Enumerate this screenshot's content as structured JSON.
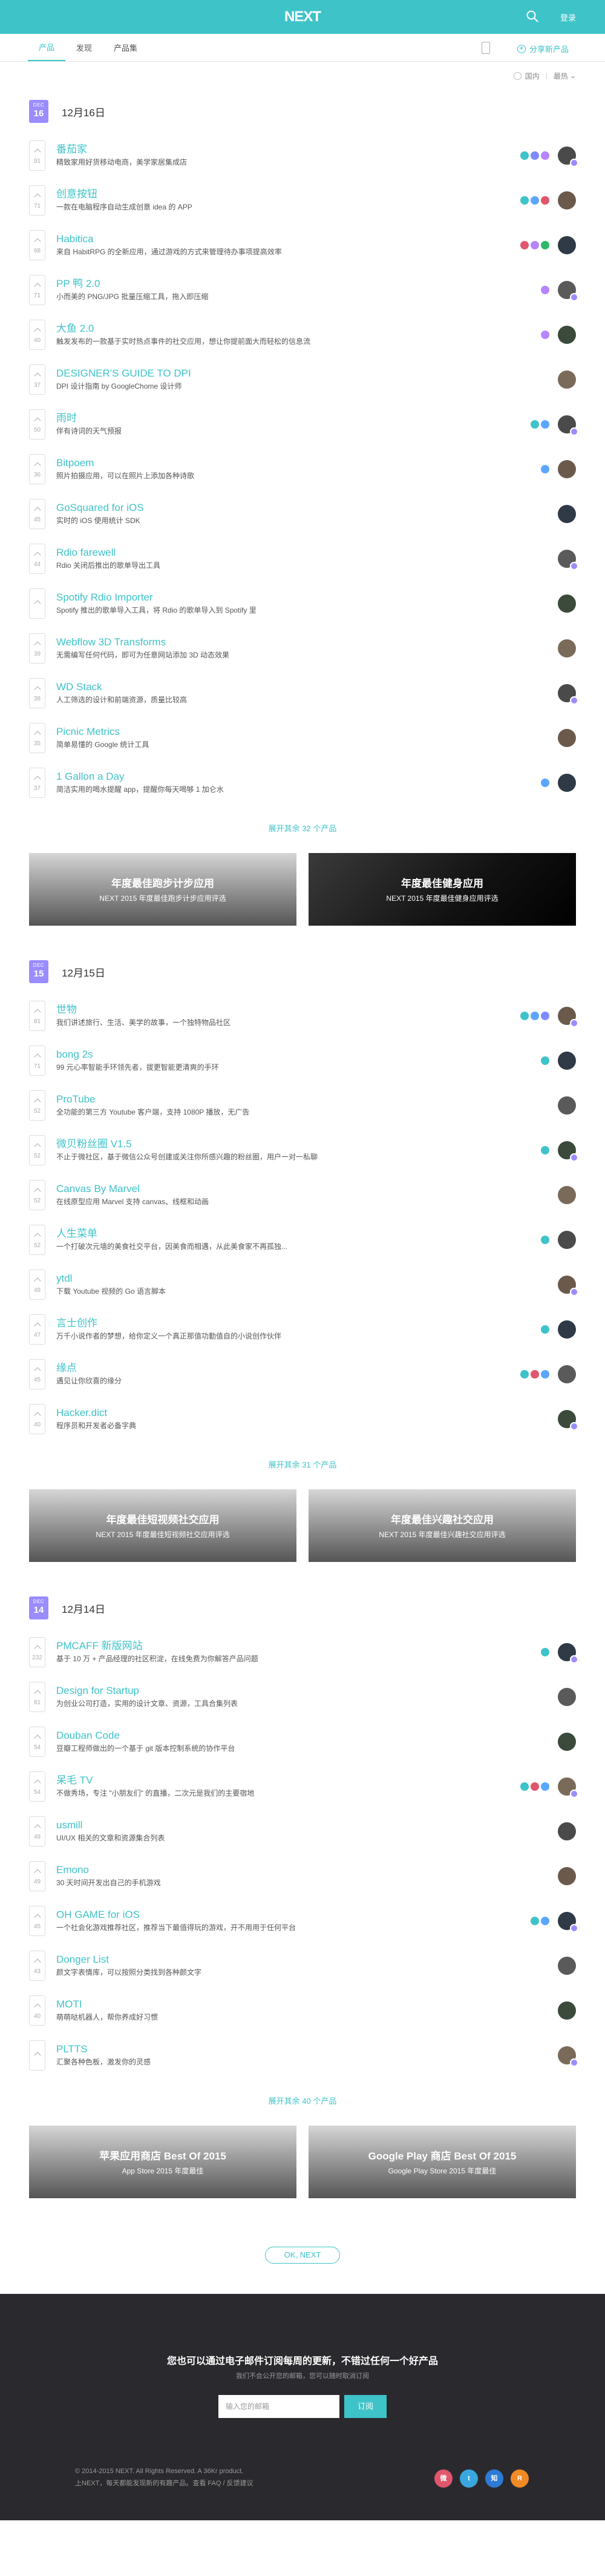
{
  "header": {
    "logo": "NEXT",
    "login": "登录"
  },
  "tabs": [
    {
      "label": "产品"
    },
    {
      "label": "发现"
    },
    {
      "label": "产品集"
    }
  ],
  "share_label": "分享新产品",
  "filter": {
    "region": "国内",
    "sort": "最热"
  },
  "days": [
    {
      "month": "DEC",
      "day": "16",
      "title": "12月16日",
      "items": [
        {
          "name": "番茄家",
          "desc": "精致家用好货移动电商，美学家居集成店",
          "votes": "91",
          "tags": [
            "#3ec3c9",
            "#7c8bff",
            "#b586ff"
          ]
        },
        {
          "name": "创意按钮",
          "desc": "一款在电脑程序自动生成创意 idea 的 APP",
          "votes": "71",
          "tags": [
            "#3ec3c9",
            "#5ca6ff",
            "#e0566c"
          ]
        },
        {
          "name": "Habitica",
          "desc": "来自 HabitRPG 的全新应用，通过游戏的方式来管理待办事项提高效率",
          "votes": "68",
          "tags": [
            "#e0566c",
            "#b586ff",
            "#2fb86a"
          ]
        },
        {
          "name": "PP 鸭 2.0",
          "desc": "小而美的 PNG/JPG 批量压缩工具，拖入即压缩",
          "votes": "71",
          "tags": [
            "#b586ff"
          ]
        },
        {
          "name": "大鱼 2.0",
          "desc": "触发发布的一款基于实时热点事件的社交应用，想让你提前面大而轻松的信息流",
          "votes": "40",
          "tags": [
            "#b586ff"
          ]
        },
        {
          "name": "DESIGNER'S GUIDE TO DPI",
          "desc": "DPI 设计指南 by GoogleChome 设计师",
          "votes": "37",
          "tags": []
        },
        {
          "name": "雨时",
          "desc": "伴有诗词的天气预报",
          "votes": "50",
          "tags": [
            "#3ec3c9",
            "#5ca6ff"
          ]
        },
        {
          "name": "Bitpoem",
          "desc": "照片拍摄应用，可以在照片上添加各种诗歌",
          "votes": "36",
          "tags": [
            "#5ca6ff"
          ]
        },
        {
          "name": "GoSquared for iOS",
          "desc": "实时的 iOS 使用统计 SDK",
          "votes": "45",
          "tags": []
        },
        {
          "name": "Rdio farewell",
          "desc": "Rdio 关闭后推出的歌单导出工具",
          "votes": "44",
          "tags": []
        },
        {
          "name": "Spotify Rdio Importer",
          "desc": "Spotify 推出的歌单导入工具，将 Rdio 的歌单导入到 Spotify 里",
          "votes": "",
          "tags": []
        },
        {
          "name": "Webflow 3D Transforms",
          "desc": "无需编写任何代码，即可为任意网站添加 3D 动态效果",
          "votes": "39",
          "tags": []
        },
        {
          "name": "WD Stack",
          "desc": "人工筛选的设计和前端资源，质量比较高",
          "votes": "38",
          "tags": []
        },
        {
          "name": "Picnic Metrics",
          "desc": "简单易懂的 Google 统计工具",
          "votes": "35",
          "tags": []
        },
        {
          "name": "1 Gallon a Day",
          "desc": "简洁实用的喝水提醒 app，提醒你每天喝够 1 加仑水",
          "votes": "37",
          "tags": [
            "#5ca6ff"
          ]
        }
      ],
      "more": "展开其余 32 个产品",
      "banners": [
        {
          "title": "年度最佳跑步计步应用",
          "sub": "NEXT 2015 年度最佳跑步计步应用评选",
          "dark": false
        },
        {
          "title": "年度最佳健身应用",
          "sub": "NEXT 2015 年度最佳健身应用评选",
          "dark": true
        }
      ]
    },
    {
      "month": "DEC",
      "day": "15",
      "title": "12月15日",
      "items": [
        {
          "name": "世物",
          "desc": "我们讲述旅行、生活、美学的故事，一个独特物品社区",
          "votes": "81",
          "tags": [
            "#3ec3c9",
            "#5ca6ff",
            "#7c8bff"
          ]
        },
        {
          "name": "bong 2s",
          "desc": "99 元心率智能手环领先者，拔更智能更清爽的手环",
          "votes": "71",
          "tags": [
            "#3ec3c9"
          ]
        },
        {
          "name": "ProTube",
          "desc": "全功能的第三方 Youtube 客户端，支持 1080P 播放，无广告",
          "votes": "52",
          "tags": []
        },
        {
          "name": "微贝粉丝圈 V1.5",
          "desc": "不止于微社区，基于微信公众号创建或关注你所感兴趣的粉丝圈，用户一对一私聊",
          "votes": "52",
          "tags": [
            "#3ec3c9"
          ]
        },
        {
          "name": "Canvas By Marvel",
          "desc": "在线原型应用 Marvel 支持 canvas、线框和动画",
          "votes": "52",
          "tags": []
        },
        {
          "name": "人生菜单",
          "desc": "一个打破次元墙的美食社交平台，因美食而相遇，从此美食家不再孤独...",
          "votes": "52",
          "tags": [
            "#3ec3c9"
          ]
        },
        {
          "name": "ytdl",
          "desc": "下载 Youtube 视频的 Go 语言脚本",
          "votes": "48",
          "tags": []
        },
        {
          "name": "言士创作",
          "desc": "万千小说作者的梦想，给你定义一个真正那值功勤值自的小说创作伙伴",
          "votes": "47",
          "tags": [
            "#3ec3c9"
          ]
        },
        {
          "name": "缘点",
          "desc": "遇见让你欣喜的缘分",
          "votes": "45",
          "tags": [
            "#3ec3c9",
            "#e0566c",
            "#5ca6ff"
          ]
        },
        {
          "name": "Hacker.dict",
          "desc": "程序员和开发者必备字典",
          "votes": "40",
          "tags": []
        }
      ],
      "more": "展开其余 31 个产品",
      "banners": [
        {
          "title": "年度最佳短视频社交应用",
          "sub": "NEXT 2015 年度最佳短视频社交应用评选",
          "dark": false
        },
        {
          "title": "年度最佳兴趣社交应用",
          "sub": "NEXT 2015 年度最佳兴趣社交应用评选",
          "dark": false
        }
      ]
    },
    {
      "month": "DEC",
      "day": "14",
      "title": "12月14日",
      "items": [
        {
          "name": "PMCAFF 新版网站",
          "desc": "基于 10 万 + 产品经理的社区积淀，在线免费为你解答产品问题",
          "votes": "232",
          "tags": [
            "#3ec3c9"
          ]
        },
        {
          "name": "Design for Startup",
          "desc": "为创业公司打造，实用的设计文章、资源，工具合集列表",
          "votes": "81",
          "tags": []
        },
        {
          "name": "Douban Code",
          "desc": "豆瓣工程师做出的一个基于 git 版本控制系统的协作平台",
          "votes": "54",
          "tags": []
        },
        {
          "name": "呆毛 TV",
          "desc": "不做秀场，专注 \"小朋友们\" 的直播，二次元是我们的主要宿地",
          "votes": "54",
          "tags": [
            "#3ec3c9",
            "#e0566c",
            "#5ca6ff"
          ]
        },
        {
          "name": "usmill",
          "desc": "UI/UX 相关的文章和资源集合列表",
          "votes": "49",
          "tags": []
        },
        {
          "name": "Emono",
          "desc": "30 天时间开发出自己的手机游戏",
          "votes": "49",
          "tags": []
        },
        {
          "name": "OH GAME for iOS",
          "desc": "一个社会化游戏推荐社区，推荐当下最值得玩的游戏，开不用用于任何平台",
          "votes": "45",
          "tags": [
            "#3ec3c9",
            "#5ca6ff"
          ]
        },
        {
          "name": "Donger List",
          "desc": "颜文字表情库，可以按照分类找到各种颜文字",
          "votes": "43",
          "tags": []
        },
        {
          "name": "MOTI",
          "desc": "萌萌哒机器人，帮你养成好习惯",
          "votes": "40",
          "tags": []
        },
        {
          "name": "PLTTS",
          "desc": "汇聚各种色板，激发你的灵感",
          "votes": "",
          "tags": []
        }
      ],
      "more": "展开其余 40 个产品",
      "banners": [
        {
          "title": "苹果应用商店 Best Of 2015",
          "sub": "App Store 2015 年度最佳",
          "dark": false
        },
        {
          "title": "Google Play 商店 Best Of 2015",
          "sub": "Google Play Store 2015 年度最佳",
          "dark": false
        }
      ]
    }
  ],
  "ok_label": "OK, NEXT",
  "footer": {
    "title": "您也可以通过电子邮件订阅每周的更新，不错过任何一个好产品",
    "sub": "我们不会公开您的邮箱，您可以随时取消订阅",
    "placeholder": "输入您的邮箱",
    "subscribe": "订阅",
    "copy1": "© 2014-2015 NEXT. All Rights Reserved. A 36Kr product.",
    "copy2": "上NEXT，每天都能发现新的有趣产品。查看 FAQ / 反馈建议"
  },
  "social": [
    {
      "label": "微",
      "color": "#e0566c"
    },
    {
      "label": "t",
      "color": "#3aa6e0"
    },
    {
      "label": "知",
      "color": "#2d7bd6"
    },
    {
      "label": "R",
      "color": "#f08a24"
    }
  ]
}
